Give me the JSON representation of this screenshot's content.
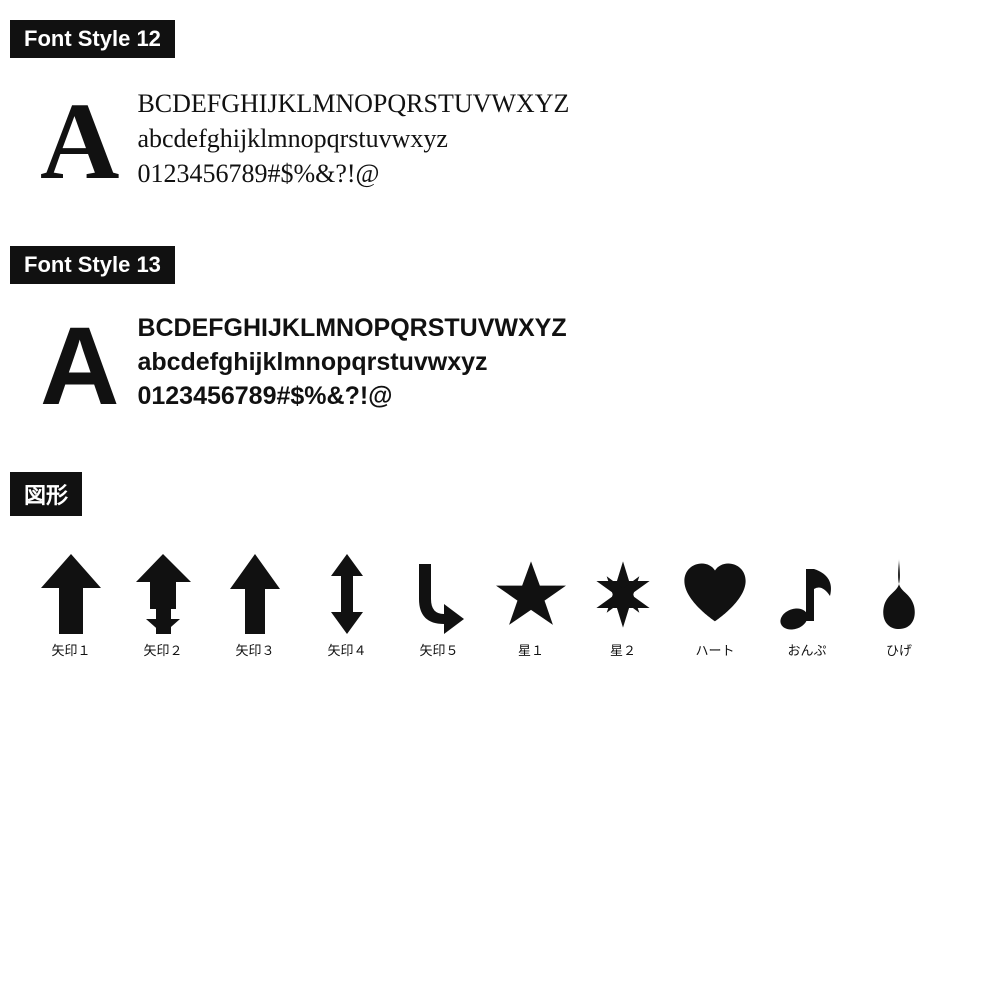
{
  "sections": [
    {
      "id": "font-style-12",
      "label": "Font Style 12",
      "big_letter": "A",
      "style": "serif",
      "lines": [
        "BCDEFGHIJKLMNOPQRSTUVWXYZ",
        "abcdefghijklmnopqrstuvwxyz",
        "0123456789#$%&?!@"
      ]
    },
    {
      "id": "font-style-13",
      "label": "Font Style 13",
      "big_letter": "A",
      "style": "sans",
      "lines": [
        "BCDEFGHIJKLMNOPQRSTUVWXYZ",
        "abcdefghijklmnopqrstuvwxyz",
        "0123456789#$%&?!@"
      ]
    },
    {
      "id": "shapes",
      "label": "図形",
      "items": [
        {
          "id": "yajirushi1",
          "label": "矢印１"
        },
        {
          "id": "yajirushi2",
          "label": "矢印２"
        },
        {
          "id": "yajirushi3",
          "label": "矢印３"
        },
        {
          "id": "yajirushi4",
          "label": "矢印４"
        },
        {
          "id": "yajirushi5",
          "label": "矢印５"
        },
        {
          "id": "hoshi1",
          "label": "星１"
        },
        {
          "id": "hoshi2",
          "label": "星２"
        },
        {
          "id": "heart",
          "label": "ハート"
        },
        {
          "id": "onpu",
          "label": "おんぷ"
        },
        {
          "id": "hige",
          "label": "ひげ"
        }
      ]
    }
  ]
}
